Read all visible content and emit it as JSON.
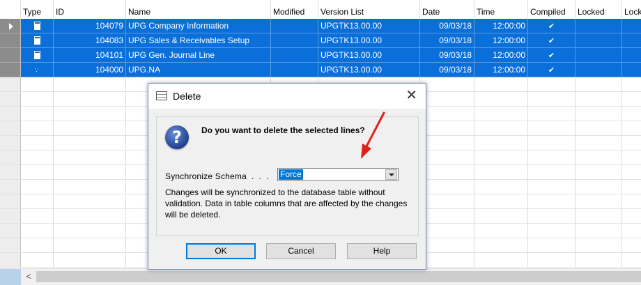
{
  "columns": [
    "Type",
    "ID",
    "Name",
    "Modified",
    "Version List",
    "Date",
    "Time",
    "Compiled",
    "Locked",
    "Lock"
  ],
  "rows": [
    {
      "type_icon": "table-object-icon",
      "id": "104079",
      "name": "UPG Company Information",
      "modified": "",
      "version": "UPGTK13.00.00",
      "date": "09/03/18",
      "time": "12:00:00",
      "compiled": "✔",
      "locked": ""
    },
    {
      "type_icon": "table-object-icon",
      "id": "104083",
      "name": "UPG Sales & Receivables Setup",
      "modified": "",
      "version": "UPGTK13.00.00",
      "date": "09/03/18",
      "time": "12:00:00",
      "compiled": "✔",
      "locked": ""
    },
    {
      "type_icon": "table-object-icon",
      "id": "104101",
      "name": "UPG Gen. Journal Line",
      "modified": "",
      "version": "UPGTK13.00.00",
      "date": "09/03/18",
      "time": "12:00:00",
      "compiled": "✔",
      "locked": ""
    },
    {
      "type_icon": "dots-object-icon",
      "id": "104000",
      "name": "UPG.NA",
      "modified": "",
      "version": "UPGTK13.00.00",
      "date": "09/03/18",
      "time": "12:00:00",
      "compiled": "✔",
      "locked": ""
    }
  ],
  "dialog": {
    "title": "Delete",
    "close_glyph": "✕",
    "question": "Do you want to delete the selected lines?",
    "question_icon": "?",
    "sync_label": "Synchronize Schema  .  .  .",
    "sync_value": "Force",
    "description": "Changes will be synchronized to the database table without validation. Data in table columns that are affected by the changes will be deleted.",
    "ok_label": "OK",
    "cancel_label": "Cancel",
    "help_label": "Help"
  },
  "scrollbar": {
    "left_glyph": "<"
  },
  "colors": {
    "selection": "#0b6fd9",
    "annotation_arrow": "#e0201a",
    "ok_border": "#0078d7"
  }
}
